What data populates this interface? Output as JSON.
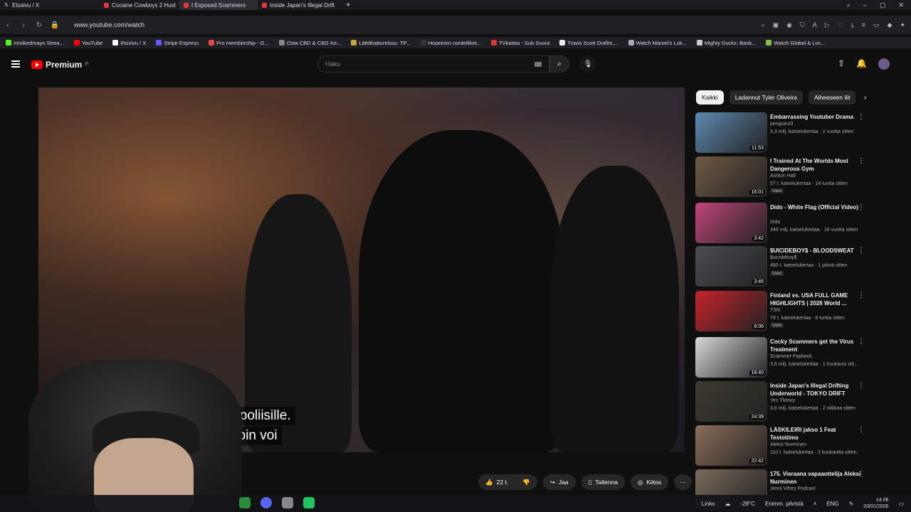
{
  "browser": {
    "tabs": [
      {
        "label": "Etusivu / X"
      },
      {
        "label": "Cocaine Cowboys 2 Hust"
      },
      {
        "label": "I Exposed Scammers"
      },
      {
        "label": "Inside Japan's Illegal Drift"
      }
    ],
    "url": "www.youtube.com/watch",
    "bookmarks": [
      "mmikedmayn Strea...",
      "YouTube",
      "Etusivu / X",
      "Stripe Express",
      "Pro membership - G...",
      "Osta CBD & CBG Ke...",
      "Lättähattureissu: TP...",
      "Hopeinen cordelliket...",
      "TVkaista - Sub Suora",
      "Travis Scott Outfits,...",
      "Watch Marvel's Luk...",
      "Mighty Ducks: Bank...",
      "Watch Global & Loc..."
    ]
  },
  "youtube": {
    "logo": "Premium",
    "logo_sup": "FI",
    "search_placeholder": "Haku"
  },
  "video": {
    "subtitle_line1": "la sitten poliisille.",
    "subtitle_line2": "ei noin voi"
  },
  "actions": {
    "likes": "22 t.",
    "share": "Jaa",
    "save": "Tallenna",
    "thanks": "Kiitos"
  },
  "chips": [
    "Kaikki",
    "Ladannut Tyler Oliveira",
    "Aiheeseen liit"
  ],
  "recommendations": [
    {
      "title": "Embarrassing Youtuber Drama",
      "channel": "penguinz0",
      "meta": "5,3 milj. katselukertaa · 2 vuotta sitten",
      "duration": "11:53",
      "new": "",
      "color": "#5d8ab0"
    },
    {
      "title": "I Trained At The Worlds Most Dangerous Gym",
      "channel": "Ashton Hall",
      "meta": "57 t. katselukertaa · 14 tuntia sitten",
      "duration": "16:01",
      "new": "Uusi",
      "color": "#6f5a44"
    },
    {
      "title": "Dido - White Flag (Official Video)",
      "channel": "Dido",
      "meta": "340 milj. katselukertaa · 16 vuotta sitten",
      "duration": "3:42",
      "new": "",
      "color": "#c0457a"
    },
    {
      "title": "$UICIDEBOY$ - BLOODSWEAT",
      "channel": "$uicideboy$",
      "meta": "480 t. katselukertaa · 1 päivä sitten",
      "duration": "3:45",
      "new": "Uusi",
      "color": "#4a4d52"
    },
    {
      "title": "Finland vs. USA FULL GAME HIGHLIGHTS | 2026 World ...",
      "channel": "TSN",
      "meta": "79 t. katselukertaa · 8 tuntia sitten",
      "duration": "8:06",
      "new": "Uusi",
      "color": "#c4232b"
    },
    {
      "title": "Cocky Scammers get the Virus Treatment",
      "channel": "Scammer Payback",
      "meta": "3,8 milj. katselukertaa · 1 kuukausi sitt...",
      "duration": "18:40",
      "new": "",
      "color": "#d8d8d8"
    },
    {
      "title": "Inside Japan's Illegal Drifting Underworld - TOKYO DRIFT",
      "channel": "Yes Theory",
      "meta": "3,6 milj. katselukertaa · 2 viikkoa sitten",
      "duration": "24:39",
      "new": "",
      "color": "#3b3b2f"
    },
    {
      "title": "LÄSKILEIRI jakso 1 Feat Testotiimo",
      "channel": "Aleksi Nurminen",
      "meta": "110 t. katselukertaa · 3 kuukautta sitten",
      "duration": "22:42",
      "new": "",
      "color": "#8b6e5a"
    },
    {
      "title": "175. Vieraana vapaaottelija Aleksi Nurminen",
      "channel": "Jenni Vihtry Podcast",
      "meta": "",
      "duration": "",
      "new": "",
      "color": "#7a6a5a"
    }
  ],
  "taskbar": {
    "links": "Links",
    "weather": "-28°C",
    "weather_text": "Enimm. pilvistä",
    "lang": "ENG",
    "time": "14.06",
    "date": "03/01/2026"
  }
}
